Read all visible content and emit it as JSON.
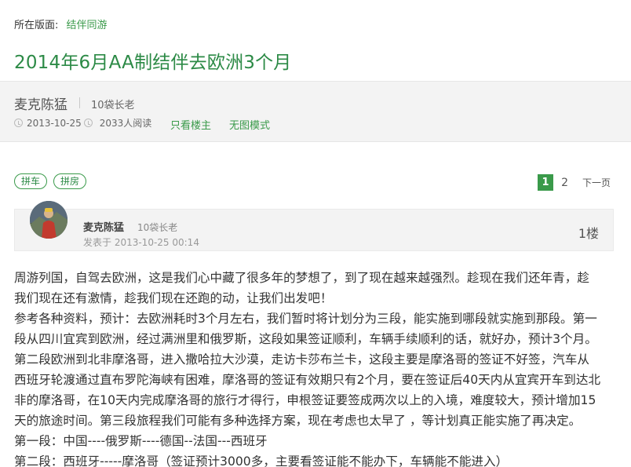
{
  "section": {
    "label": "所在版面:",
    "value": "结伴同游"
  },
  "thread": {
    "title": "2014年6月AA制结伴去欧洲3个月"
  },
  "info": {
    "author": "麦克陈猛",
    "rank": "10袋长老",
    "date": "2013-10-25",
    "views": "2033人阅读",
    "only_op": "只看楼主",
    "no_images": "无图模式"
  },
  "tags": [
    "拼车",
    "拼房"
  ],
  "pager": {
    "current": "1",
    "page2": "2",
    "next": "下一页"
  },
  "post": {
    "author": "麦克陈猛",
    "rank": "10袋长老",
    "time": "发表于 2013-10-25 00:14",
    "floor": "1楼",
    "lines": [
      "周游列国，自驾去欧洲，这是我们心中藏了很多年的梦想了，到了现在越来越强烈。趁现在我们还年青，趁",
      "我们现在还有激情，趁我们现在还跑的动，让我们出发吧！",
      "参考各种资料，预计：去欧洲耗时3个月左右，我们暂时将计划分为三段，能实施到哪段就实施到那段。第一",
      "段从四川宜宾到欧洲，经过满洲里和俄罗斯，这段如果签证顺利，车辆手续顺利的话，就好办，预计3个月。",
      "第二段欧洲到北非摩洛哥，进入撒哈拉大沙漠，走访卡莎布兰卡，这段主要是摩洛哥的签证不好签，汽车从",
      "西班牙轮渡通过直布罗陀海峡有困难，摩洛哥的签证有效期只有2个月，要在签证后40天内从宜宾开车到达北",
      "非的摩洛哥，在10天内完成摩洛哥的旅行才得行，申根签证要签成两次以上的入境，难度较大，预计增加15",
      "天的旅途时间。第三段旅程我们可能有多种选择方案，现在考虑也太早了 ，等计划真正能实施了再决定。",
      "第一段：中国----俄罗斯----德国--法国---西班牙",
      "第二段：西班牙-----摩洛哥（签证预计3000多，主要看签证能不能办下，车辆能不能进入）"
    ]
  }
}
